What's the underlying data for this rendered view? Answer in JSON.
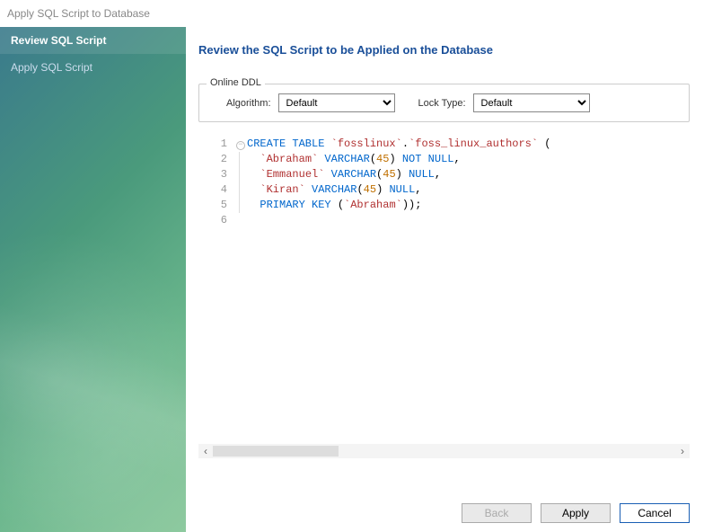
{
  "window": {
    "title": "Apply SQL Script to Database"
  },
  "sidebar": {
    "items": [
      {
        "label": "Review SQL Script",
        "name": "sidebar-item-review",
        "active": true
      },
      {
        "label": "Apply SQL Script",
        "name": "sidebar-item-apply",
        "active": false
      }
    ]
  },
  "main": {
    "heading": "Review the SQL Script to be Applied on the Database",
    "ddl": {
      "legend": "Online DDL",
      "algorithm_label": "Algorithm:",
      "algorithm_value": "Default",
      "locktype_label": "Lock Type:",
      "locktype_value": "Default"
    },
    "code": {
      "lines": [
        "1",
        "2",
        "3",
        "4",
        "5",
        "6"
      ],
      "tokens": [
        [
          {
            "k": "kw",
            "t": "CREATE TABLE "
          },
          {
            "k": "ident",
            "t": "`fosslinux`"
          },
          {
            "k": "",
            "t": "."
          },
          {
            "k": "ident",
            "t": "`foss_linux_authors`"
          },
          {
            "k": "",
            "t": " ("
          }
        ],
        [
          {
            "k": "",
            "t": "  "
          },
          {
            "k": "ident",
            "t": "`Abraham`"
          },
          {
            "k": "",
            "t": " "
          },
          {
            "k": "kw",
            "t": "VARCHAR"
          },
          {
            "k": "",
            "t": "("
          },
          {
            "k": "num",
            "t": "45"
          },
          {
            "k": "",
            "t": ") "
          },
          {
            "k": "kw",
            "t": "NOT NULL"
          },
          {
            "k": "",
            "t": ","
          }
        ],
        [
          {
            "k": "",
            "t": "  "
          },
          {
            "k": "ident",
            "t": "`Emmanuel`"
          },
          {
            "k": "",
            "t": " "
          },
          {
            "k": "kw",
            "t": "VARCHAR"
          },
          {
            "k": "",
            "t": "("
          },
          {
            "k": "num",
            "t": "45"
          },
          {
            "k": "",
            "t": ") "
          },
          {
            "k": "kw",
            "t": "NULL"
          },
          {
            "k": "",
            "t": ","
          }
        ],
        [
          {
            "k": "",
            "t": "  "
          },
          {
            "k": "ident",
            "t": "`Kiran`"
          },
          {
            "k": "",
            "t": " "
          },
          {
            "k": "kw",
            "t": "VARCHAR"
          },
          {
            "k": "",
            "t": "("
          },
          {
            "k": "num",
            "t": "45"
          },
          {
            "k": "",
            "t": ") "
          },
          {
            "k": "kw",
            "t": "NULL"
          },
          {
            "k": "",
            "t": ","
          }
        ],
        [
          {
            "k": "",
            "t": "  "
          },
          {
            "k": "kw",
            "t": "PRIMARY KEY"
          },
          {
            "k": "",
            "t": " ("
          },
          {
            "k": "ident",
            "t": "`Abraham`"
          },
          {
            "k": "",
            "t": "));"
          }
        ],
        []
      ]
    },
    "buttons": {
      "back": "Back",
      "apply": "Apply",
      "cancel": "Cancel"
    }
  }
}
